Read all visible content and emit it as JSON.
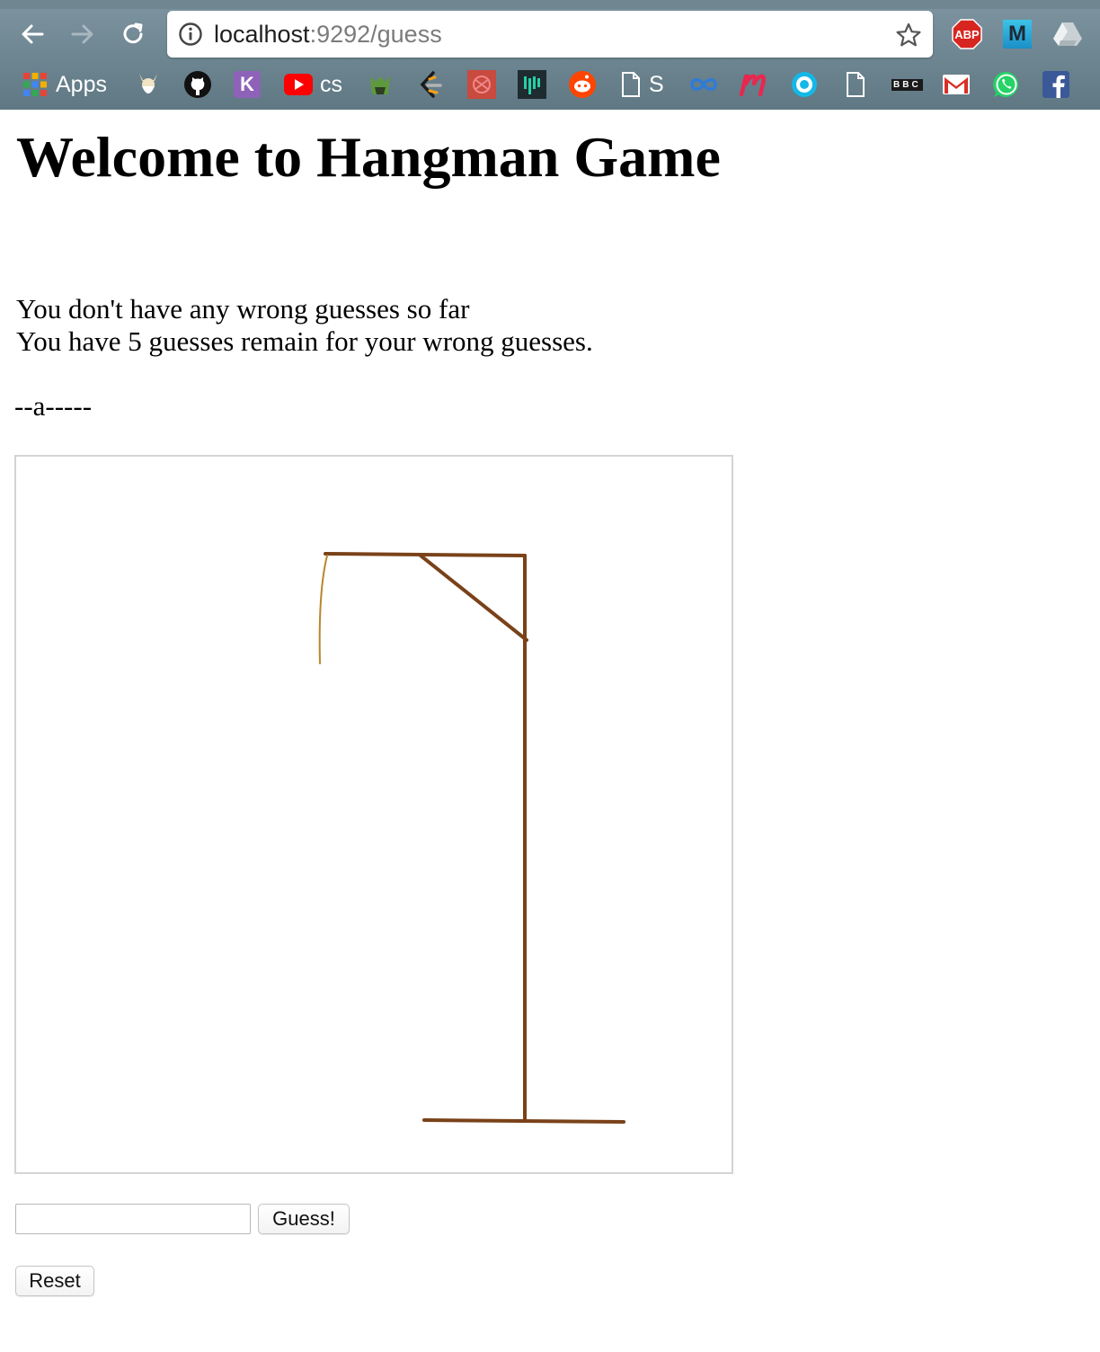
{
  "browser": {
    "url_host": "localhost",
    "url_rest": ":9292/guess",
    "bookmarks": {
      "apps": "Apps",
      "cs": "cs",
      "s": "S",
      "bbc": "BBC"
    },
    "extensions": {
      "adblock": "ABP",
      "m": "M"
    }
  },
  "page": {
    "title": "Welcome to Hangman Game",
    "wrong_guesses": "You don't have any wrong guesses so far",
    "remaining": "You have 5 guesses remain for your wrong guesses.",
    "word": "--a-----",
    "guess_button": "Guess!",
    "reset_button": "Reset",
    "guess_input_value": ""
  },
  "colors": {
    "gallows": "#7a4219",
    "rope": "#b9862a"
  }
}
